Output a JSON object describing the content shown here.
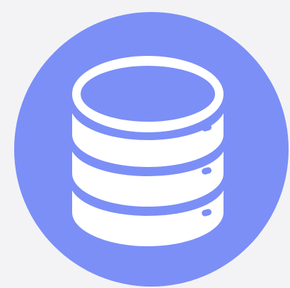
{
  "icon": {
    "name": "database-icon",
    "background_color": "#f3f3f5",
    "circle_color": "#7b8ff7",
    "glyph_color": "#ffffff"
  }
}
